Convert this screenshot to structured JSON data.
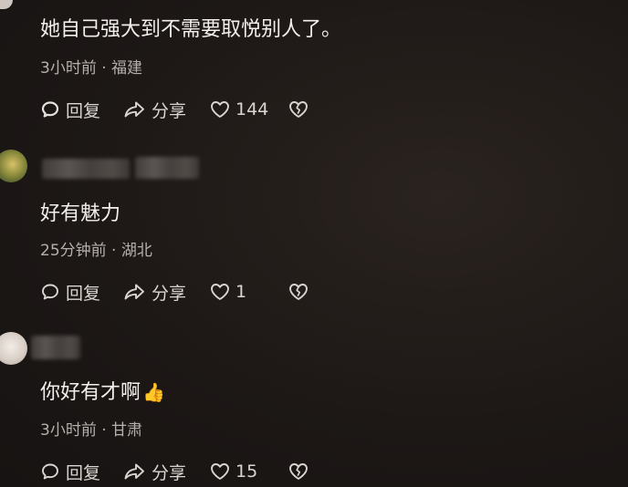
{
  "comments": [
    {
      "text": "她自己强大到不需要取悦别人了。",
      "time": "3小时前",
      "location": "福建",
      "reply_label": "回复",
      "share_label": "分享",
      "likes": "144"
    },
    {
      "text": "好有魅力",
      "time": "25分钟前",
      "location": "湖北",
      "reply_label": "回复",
      "share_label": "分享",
      "likes": "1"
    },
    {
      "text": "你好有才啊",
      "emoji": "👍",
      "time": "3小时前",
      "location": "甘肃",
      "reply_label": "回复",
      "share_label": "分享",
      "likes": "15"
    }
  ],
  "meta_separator": " · ",
  "icons": {
    "reply": "speech-bubble-icon",
    "share": "share-arrow-icon",
    "like": "heart-outline-icon",
    "dislike": "broken-heart-icon"
  }
}
